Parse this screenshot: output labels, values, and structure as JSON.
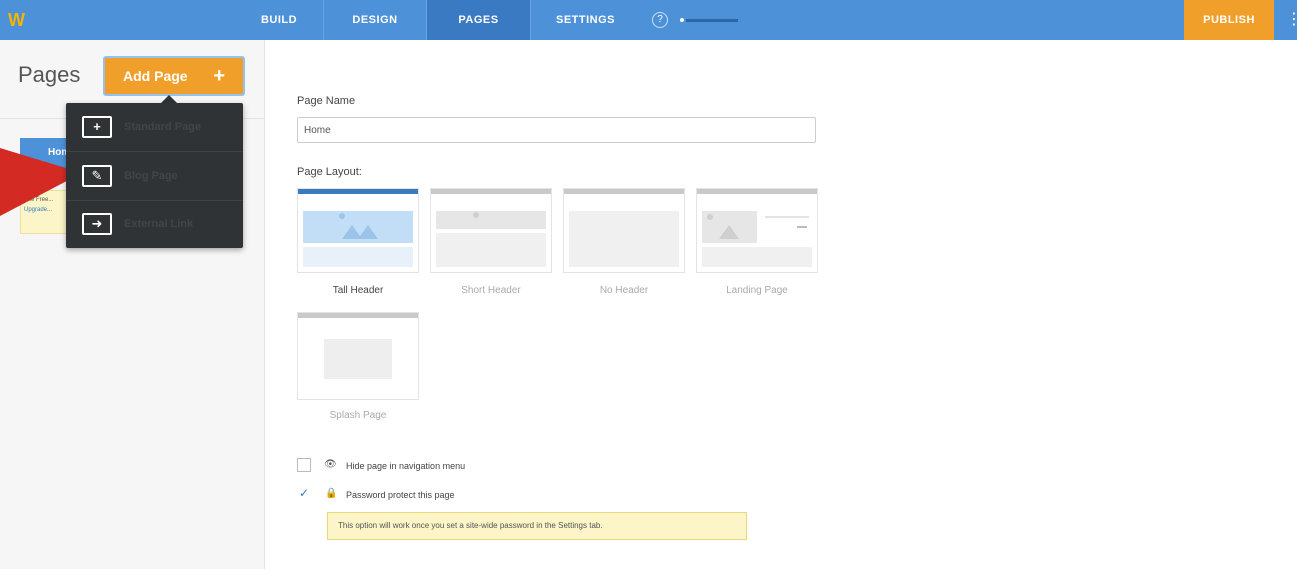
{
  "topbar": {
    "logo": "W",
    "tabs": [
      {
        "label": "BUILD",
        "active": false
      },
      {
        "label": "DESIGN",
        "active": false
      },
      {
        "label": "PAGES",
        "active": true
      },
      {
        "label": "SETTINGS",
        "active": false
      }
    ],
    "publish_label": "PUBLISH",
    "accent_color": "#4d91d8",
    "publish_color": "#f0a02a"
  },
  "sidebar": {
    "title": "Pages",
    "add_page_label": "Add Page",
    "add_page_plus": "+",
    "home_label": "Home",
    "notice_text": "The Free...",
    "notice_link": "Upgrade..."
  },
  "dropdown": {
    "items": [
      {
        "label": "Standard Page",
        "icon": "add-page-icon"
      },
      {
        "label": "Blog Page",
        "icon": "blog-edit-icon"
      },
      {
        "label": "External Link",
        "icon": "external-link-icon"
      }
    ]
  },
  "form": {
    "page_name_label": "Page Name",
    "page_name_value": "Home",
    "page_layout_label": "Page Layout:",
    "layouts": [
      {
        "name": "Tall Header",
        "selected": true
      },
      {
        "name": "Short Header",
        "selected": false
      },
      {
        "name": "No Header",
        "selected": false
      },
      {
        "name": "Landing Page",
        "selected": false
      },
      {
        "name": "Splash Page",
        "selected": false
      }
    ],
    "hide_nav_label": "Hide page in navigation menu",
    "hide_nav_checked": false,
    "password_label": "Password protect this page",
    "password_checked": true,
    "password_note": "This option will work once you set a site-wide password in the Settings tab."
  }
}
